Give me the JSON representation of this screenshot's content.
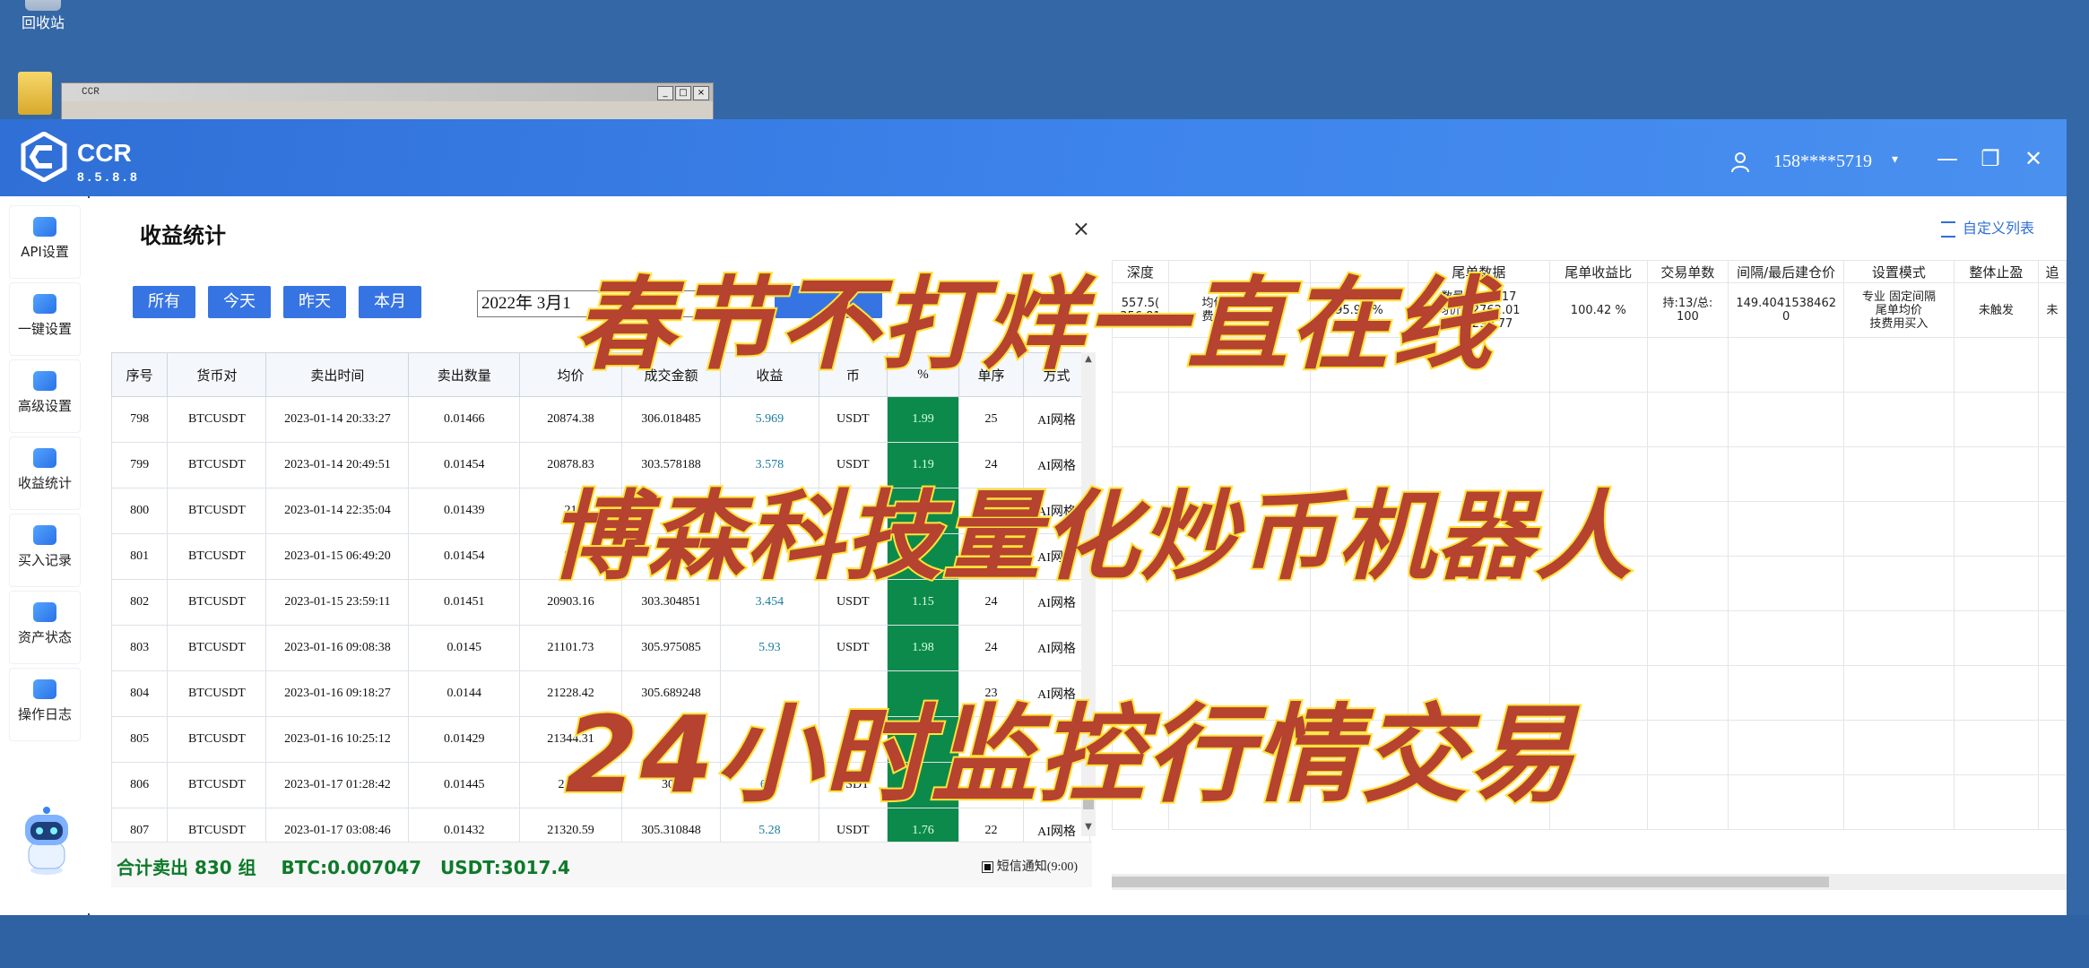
{
  "desktop": {
    "recycle_label": "回收站",
    "bg_window_title": "CCR"
  },
  "app": {
    "logo_text": "CCR",
    "version": "8.5.8.8",
    "user": "158****5719",
    "caret": "▾",
    "win_min": "—",
    "win_max": "❐",
    "win_close": "✕"
  },
  "sidebar": {
    "items": [
      {
        "label": "API设置"
      },
      {
        "label": "一键设置"
      },
      {
        "label": "高级设置"
      },
      {
        "label": "收益统计"
      },
      {
        "label": "买入记录"
      },
      {
        "label": "资产状态"
      },
      {
        "label": "操作日志"
      }
    ]
  },
  "right_panel": {
    "custom_columns": "自定义列表",
    "headers": [
      "深度",
      "",
      "",
      "尾单数据",
      "尾单收益比",
      "交易单数",
      "间隔/最后建仓价",
      "设置模式",
      "整体止盈",
      "追"
    ],
    "row": {
      "c0": "557.5(\n356.81",
      "c1": "均价:23837.4\n费用:2696.52",
      "c2": "95.91 %",
      "c3": "数量:0.01317\n均价:22762.01\n费用:299.77",
      "c4": "100.42 %",
      "c5": "持:13/总:\n100",
      "c6": "149.4041538462\n0",
      "c7": "专业 固定间隔\n尾单均价\n技费用买入",
      "c8": "未触发",
      "c9": "未"
    }
  },
  "dialog": {
    "title": "收益统计",
    "close": "×",
    "filters": [
      "所有",
      "今天",
      "昨天",
      "本月"
    ],
    "date_value": "2022年  3月1",
    "columns": [
      "序号",
      "货币对",
      "卖出时间",
      "卖出数量",
      "均价",
      "成交金额",
      "收益",
      "币",
      "%",
      "单序",
      "方式"
    ],
    "rows": [
      [
        "798",
        "BTCUSDT",
        "2023-01-14 20:33:27",
        "0.01466",
        "20874.38",
        "306.018485",
        "5.969",
        "USDT",
        "1.99",
        "25",
        "AI网格"
      ],
      [
        "799",
        "BTCUSDT",
        "2023-01-14 20:49:51",
        "0.01454",
        "20878.83",
        "303.578188",
        "3.578",
        "USDT",
        "1.19",
        "24",
        "AI网格"
      ],
      [
        "800",
        "BTCUSDT",
        "2023-01-14 22:35:04",
        "0.01439",
        "21",
        "",
        "",
        "",
        "",
        "",
        "AI网格"
      ],
      [
        "801",
        "BTCUSDT",
        "2023-01-15 06:49:20",
        "0.01454",
        "20",
        "",
        "",
        "",
        "",
        "24",
        "AI网格"
      ],
      [
        "802",
        "BTCUSDT",
        "2023-01-15 23:59:11",
        "0.01451",
        "20903.16",
        "303.304851",
        "3.454",
        "USDT",
        "1.15",
        "24",
        "AI网格"
      ],
      [
        "803",
        "BTCUSDT",
        "2023-01-16 09:08:38",
        "0.0145",
        "21101.73",
        "305.975085",
        "5.93",
        "USDT",
        "1.98",
        "24",
        "AI网格"
      ],
      [
        "804",
        "BTCUSDT",
        "2023-01-16 09:18:27",
        "0.0144",
        "21228.42",
        "305.689248",
        "",
        "",
        "",
        "23",
        "AI网格"
      ],
      [
        "805",
        "BTCUSDT",
        "2023-01-16 10:25:12",
        "0.01429",
        "21344.31",
        "",
        "",
        "",
        "",
        "",
        ""
      ],
      [
        "806",
        "BTCUSDT",
        "2023-01-17 01:28:42",
        "0.01445",
        "2106",
        "304",
        "656",
        "USDT",
        "",
        "",
        ""
      ],
      [
        "807",
        "BTCUSDT",
        "2023-01-17 03:08:46",
        "0.01432",
        "21320.59",
        "305.310848",
        "5.28",
        "USDT",
        "1.76",
        "22",
        "AI网格"
      ]
    ],
    "summary": "合计卖出 830 组    BTC:0.007047   USDT:3017.4",
    "sms_label": "短信通知(9:00)"
  },
  "overlay": {
    "line1": "春节不打烊一直在线",
    "line2": "博森科技量化炒币机器人",
    "line3": "24小时监控行情交易"
  }
}
